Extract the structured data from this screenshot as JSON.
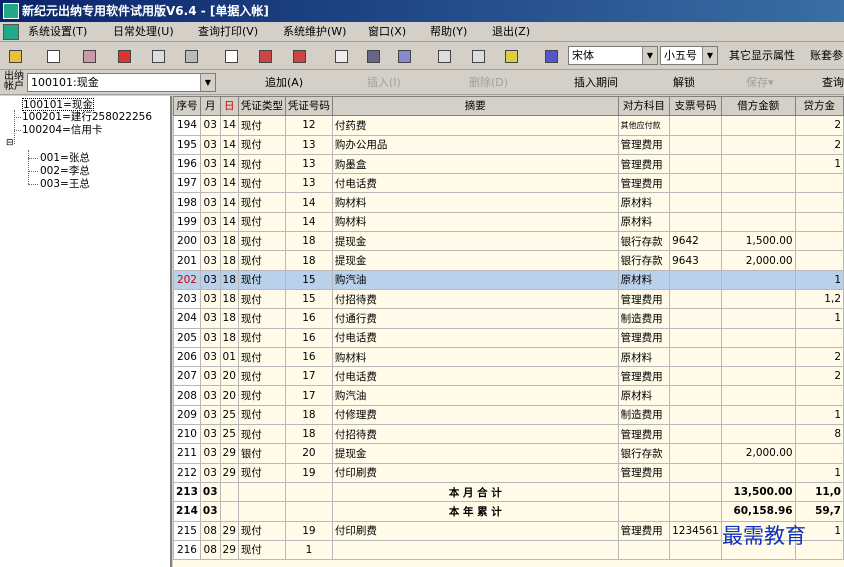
{
  "title": "新纪元出纳专用软件试用版V6.4 - [单据入帐]",
  "menu": [
    "系统设置(T)",
    "日常处理(U)",
    "查询打印(V)",
    "系统维护(W)",
    "窗口(X)",
    "帮助(Y)",
    "退出(Z)"
  ],
  "toolbar": {
    "font": "宋体",
    "size": "小五号",
    "other_attrs": "其它显示属性",
    "account_set": "账套参"
  },
  "account_label": "出纳帐户",
  "account_value": "100101:现金",
  "actions": {
    "add": "追加(A)",
    "insert": "插入(I)",
    "delete": "删除(D)",
    "insert_period": "插入期间",
    "unlock": "解锁",
    "save": "保存▾",
    "query": "查询"
  },
  "tree": [
    "100101=现金",
    "100201=建行258022256",
    "100204=信用卡",
    "001=张总",
    "002=李总",
    "003=王总"
  ],
  "headers": [
    "序号",
    "月",
    "日",
    "凭证类型",
    "凭证号码",
    "摘要",
    "对方科目",
    "支票号码",
    "借方金额",
    "贷方金"
  ],
  "rows": [
    [
      "194",
      "03",
      "14",
      "现付",
      "12",
      "付药费",
      "其他应付款",
      "",
      "",
      "",
      " 2"
    ],
    [
      "195",
      "03",
      "14",
      "现付",
      "13",
      "购办公用品",
      "管理费用",
      "",
      "",
      "2"
    ],
    [
      "196",
      "03",
      "14",
      "现付",
      "13",
      "购墨盒",
      "管理费用",
      "",
      "",
      "1"
    ],
    [
      "197",
      "03",
      "14",
      "现付",
      "13",
      "付电话费",
      "管理费用",
      "",
      "",
      ""
    ],
    [
      "198",
      "03",
      "14",
      "现付",
      "14",
      "购材料",
      "原材料",
      "",
      "",
      ""
    ],
    [
      "199",
      "03",
      "14",
      "现付",
      "14",
      "购材料",
      "原材料",
      "",
      "",
      ""
    ],
    [
      "200",
      "03",
      "18",
      "现付",
      "18",
      "提现金",
      "银行存款",
      "9642",
      "1,500.00",
      ""
    ],
    [
      "201",
      "03",
      "18",
      "现付",
      "18",
      "提现金",
      "银行存款",
      "9643",
      "2,000.00",
      ""
    ],
    [
      "202",
      "03",
      "18",
      "现付",
      "15",
      "购汽油",
      "原材料",
      "",
      "",
      "1"
    ],
    [
      "203",
      "03",
      "18",
      "现付",
      "15",
      "付招待费",
      "管理费用",
      "",
      "",
      "1,2"
    ],
    [
      "204",
      "03",
      "18",
      "现付",
      "16",
      "付通行费",
      "制造费用",
      "",
      "",
      "1"
    ],
    [
      "205",
      "03",
      "18",
      "现付",
      "16",
      "付电话费",
      "管理费用",
      "",
      "",
      ""
    ],
    [
      "206",
      "03",
      "01",
      "现付",
      "16",
      "购材料",
      "原材料",
      "",
      "",
      "2"
    ],
    [
      "207",
      "03",
      "20",
      "现付",
      "17",
      "付电话费",
      "管理费用",
      "",
      "",
      "2"
    ],
    [
      "208",
      "03",
      "20",
      "现付",
      "17",
      "购汽油",
      "原材料",
      "",
      "",
      ""
    ],
    [
      "209",
      "03",
      "25",
      "现付",
      "18",
      "付修理费",
      "制造费用",
      "",
      "",
      "1"
    ],
    [
      "210",
      "03",
      "25",
      "现付",
      "18",
      "付招待费",
      "管理费用",
      "",
      "",
      "8"
    ],
    [
      "211",
      "03",
      "29",
      "银付",
      "20",
      "提现金",
      "银行存款",
      "",
      "2,000.00",
      ""
    ],
    [
      "212",
      "03",
      "29",
      "现付",
      "19",
      "付印刷费",
      "管理费用",
      "",
      "",
      "1"
    ],
    [
      "213",
      "03",
      "",
      "",
      "",
      "本 月 合 计",
      "",
      "",
      "13,500.00",
      "11,0"
    ],
    [
      "214",
      "03",
      "",
      "",
      "",
      "本 年 累 计",
      "",
      "",
      "60,158.96",
      "59,7"
    ],
    [
      "215",
      "08",
      "29",
      "现付",
      "19",
      "付印刷费",
      "管理费用",
      "1234561",
      "",
      "1"
    ],
    [
      "216",
      "08",
      "29",
      "现付",
      "1",
      "",
      "",
      "",
      "",
      ""
    ]
  ],
  "watermark": "最需教育"
}
